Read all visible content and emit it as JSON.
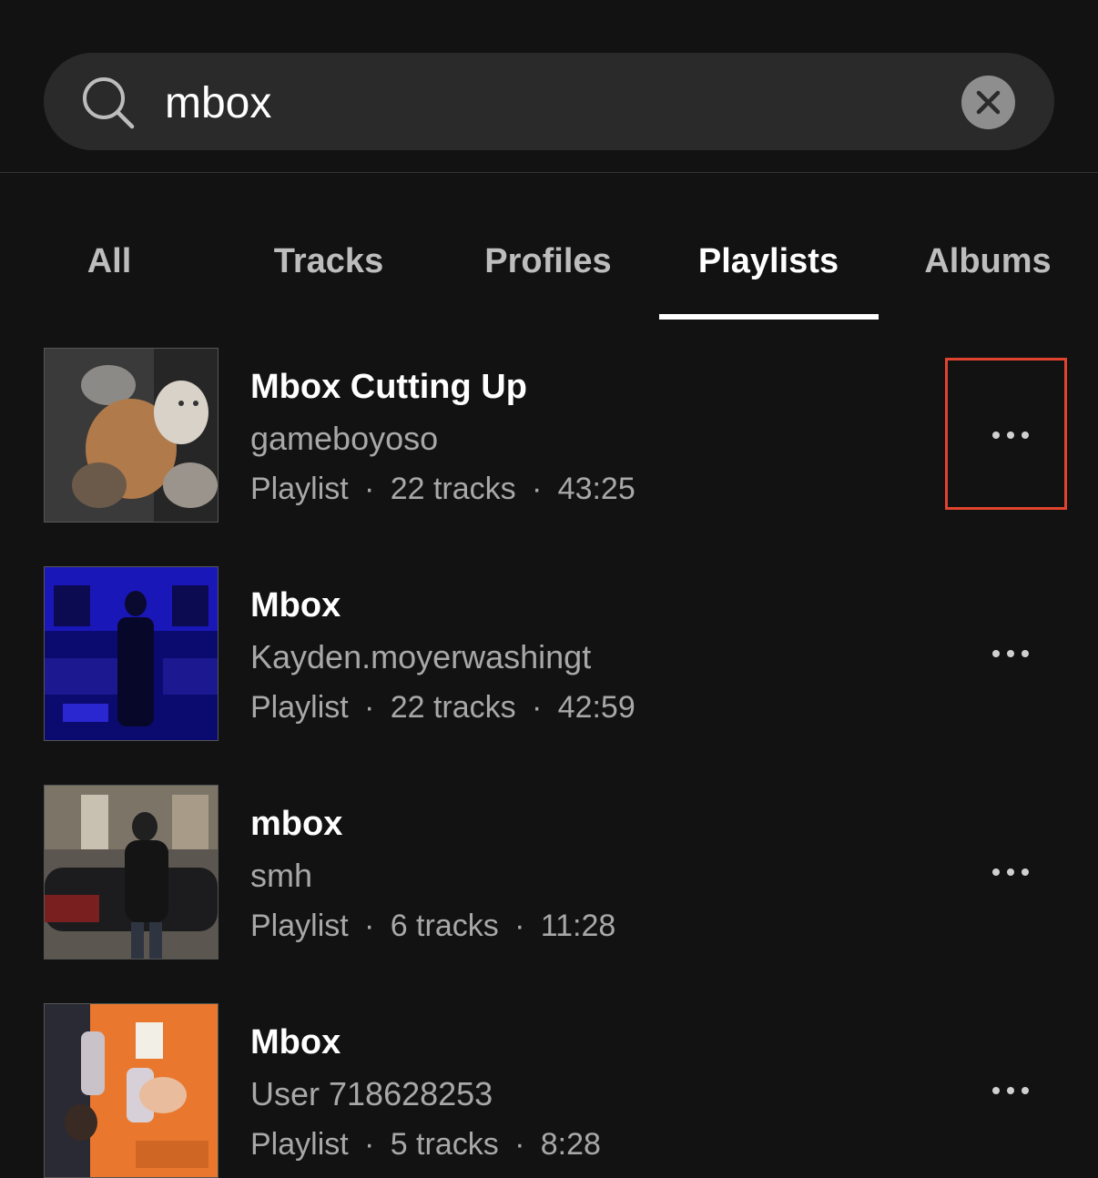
{
  "search": {
    "query": "mbox",
    "icon": "search-icon",
    "clear_icon": "close-icon"
  },
  "tabs": [
    {
      "label": "All",
      "active": false
    },
    {
      "label": "Tracks",
      "active": false
    },
    {
      "label": "Profiles",
      "active": false
    },
    {
      "label": "Playlists",
      "active": true
    },
    {
      "label": "Albums",
      "active": false
    }
  ],
  "results": [
    {
      "title": "Mbox Cutting Up",
      "owner": "gameboyoso",
      "type": "Playlist",
      "tracks": "22 tracks",
      "duration": "43:25",
      "separator": "·"
    },
    {
      "title": "Mbox",
      "owner": "Kayden.moyerwashingt",
      "type": "Playlist",
      "tracks": "22 tracks",
      "duration": "42:59",
      "separator": "·"
    },
    {
      "title": "mbox",
      "owner": "smh",
      "type": "Playlist",
      "tracks": "6 tracks",
      "duration": "11:28",
      "separator": "·"
    },
    {
      "title": "Mbox",
      "owner": "User 718628253",
      "type": "Playlist",
      "tracks": "5 tracks",
      "duration": "8:28",
      "separator": "·"
    }
  ],
  "colors": {
    "background": "#121212",
    "search_bg": "#2a2a2a",
    "highlight": "#e0442e",
    "secondary_text": "#a8a8a8"
  }
}
